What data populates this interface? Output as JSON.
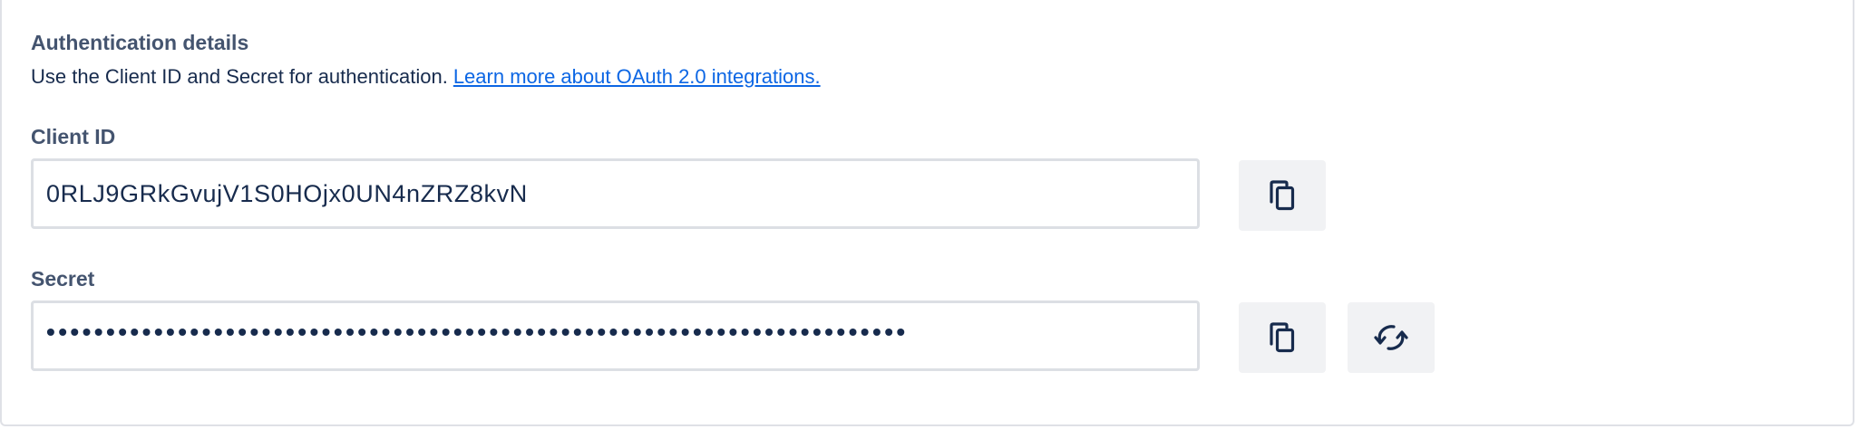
{
  "auth": {
    "title": "Authentication details",
    "description": "Use the Client ID and Secret for authentication.",
    "learn_more_link": "Learn more about OAuth 2.0 integrations."
  },
  "client_id": {
    "label": "Client ID",
    "value": "0RLJ9GRkGvujV1S0HOjx0UN4nZRZ8kvN",
    "copy_icon": "copy-icon"
  },
  "secret": {
    "label": "Secret",
    "masked_value": "••••••••••••••••••••••••••••••••••••••••••••••••••••••••••••••••••••••••",
    "copy_icon": "copy-icon",
    "rotate_icon": "refresh-icon"
  },
  "colors": {
    "link": "#0c66e4",
    "label": "#44546f",
    "text": "#172b4d",
    "field_border": "#dcdfe4",
    "button_bg": "#f1f2f4"
  }
}
